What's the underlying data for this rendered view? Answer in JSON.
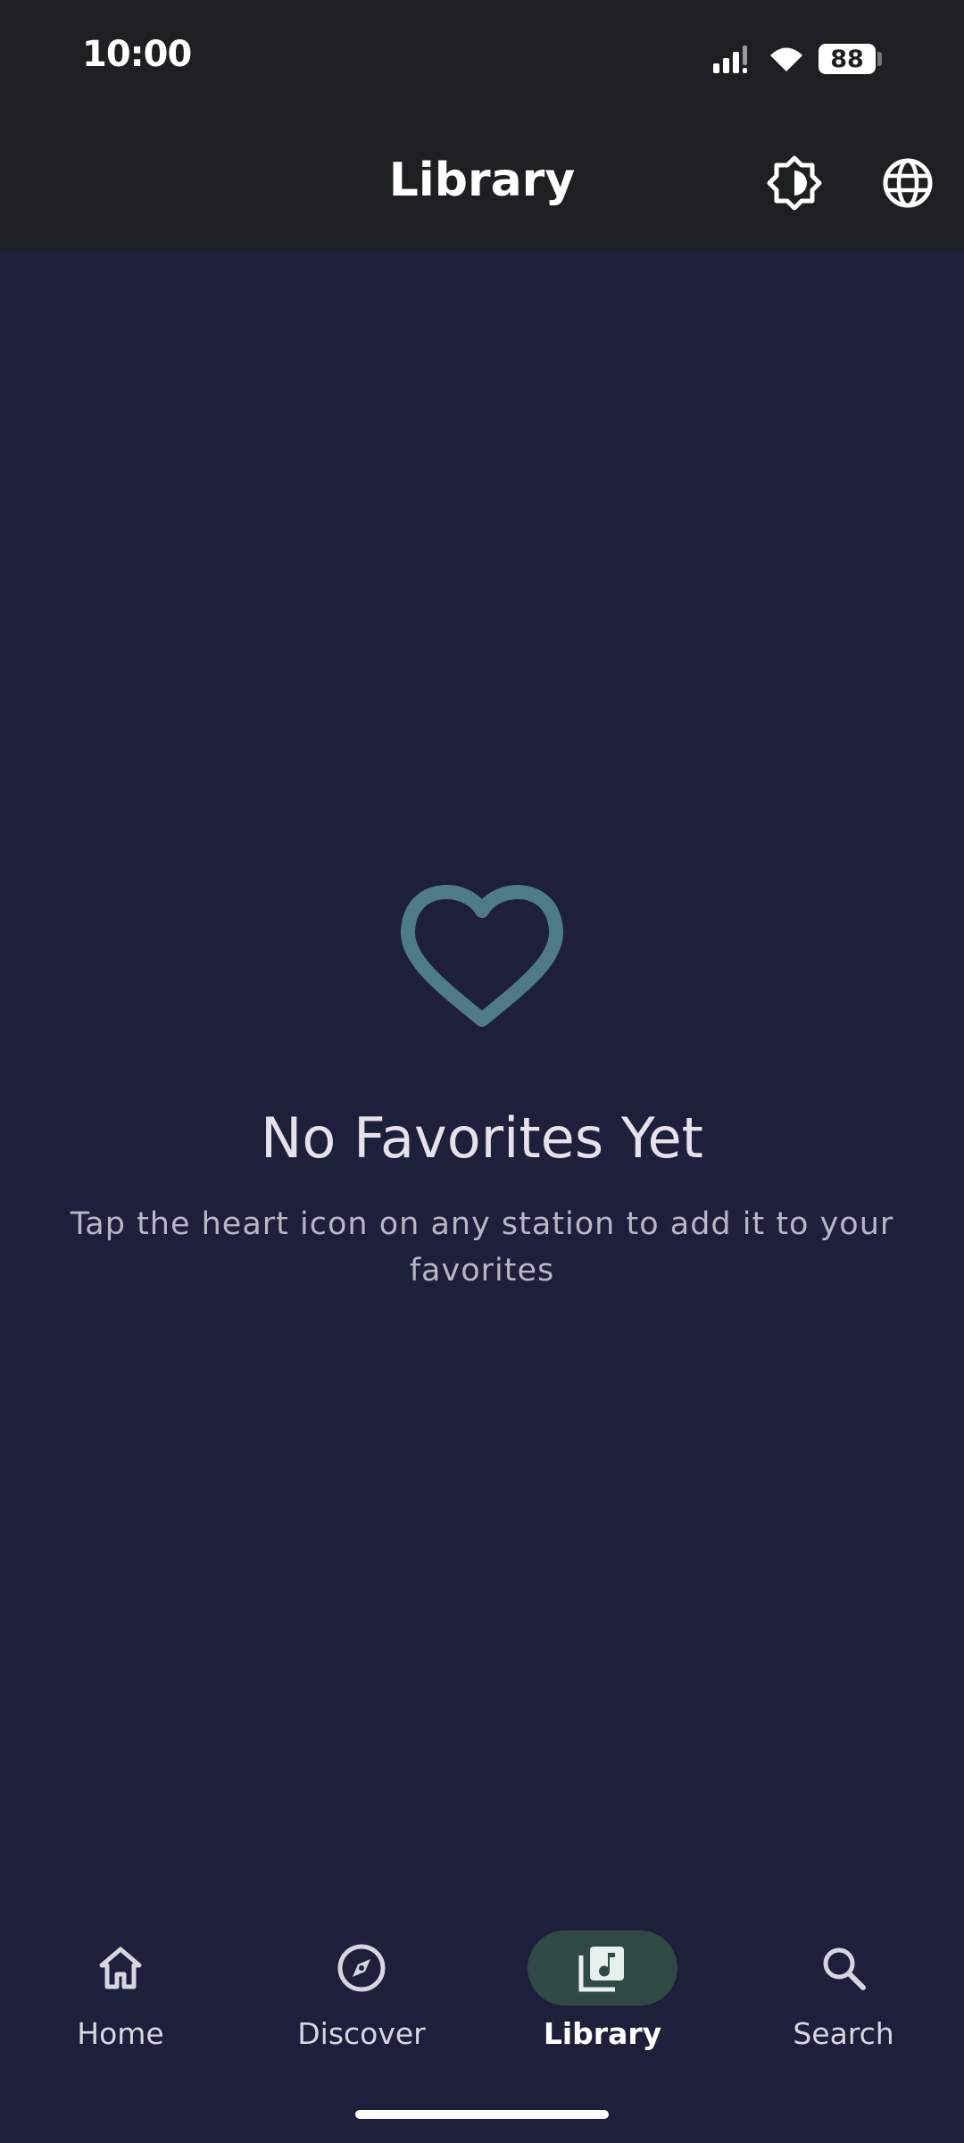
{
  "status_bar": {
    "time": "10:00",
    "battery": "88",
    "icons": [
      "signal-icon",
      "wifi-icon",
      "battery-icon"
    ]
  },
  "app_bar": {
    "title": "Library",
    "actions": [
      "brightness-icon",
      "globe-icon"
    ]
  },
  "empty_state": {
    "icon": "heart-outline-icon",
    "title": "No Favorites Yet",
    "subtitle": "Tap the heart icon on any station to add it to your favorites"
  },
  "nav": {
    "items": [
      {
        "label": "Home",
        "icon": "home-icon"
      },
      {
        "label": "Discover",
        "icon": "compass-icon"
      },
      {
        "label": "Library",
        "icon": "library-music-icon",
        "active": true
      },
      {
        "label": "Search",
        "icon": "search-icon"
      }
    ]
  },
  "colors": {
    "background": "#1d1f3b",
    "header": "#1c2021",
    "heart": "#4e7b86",
    "active_pill": "#2f4a44"
  }
}
